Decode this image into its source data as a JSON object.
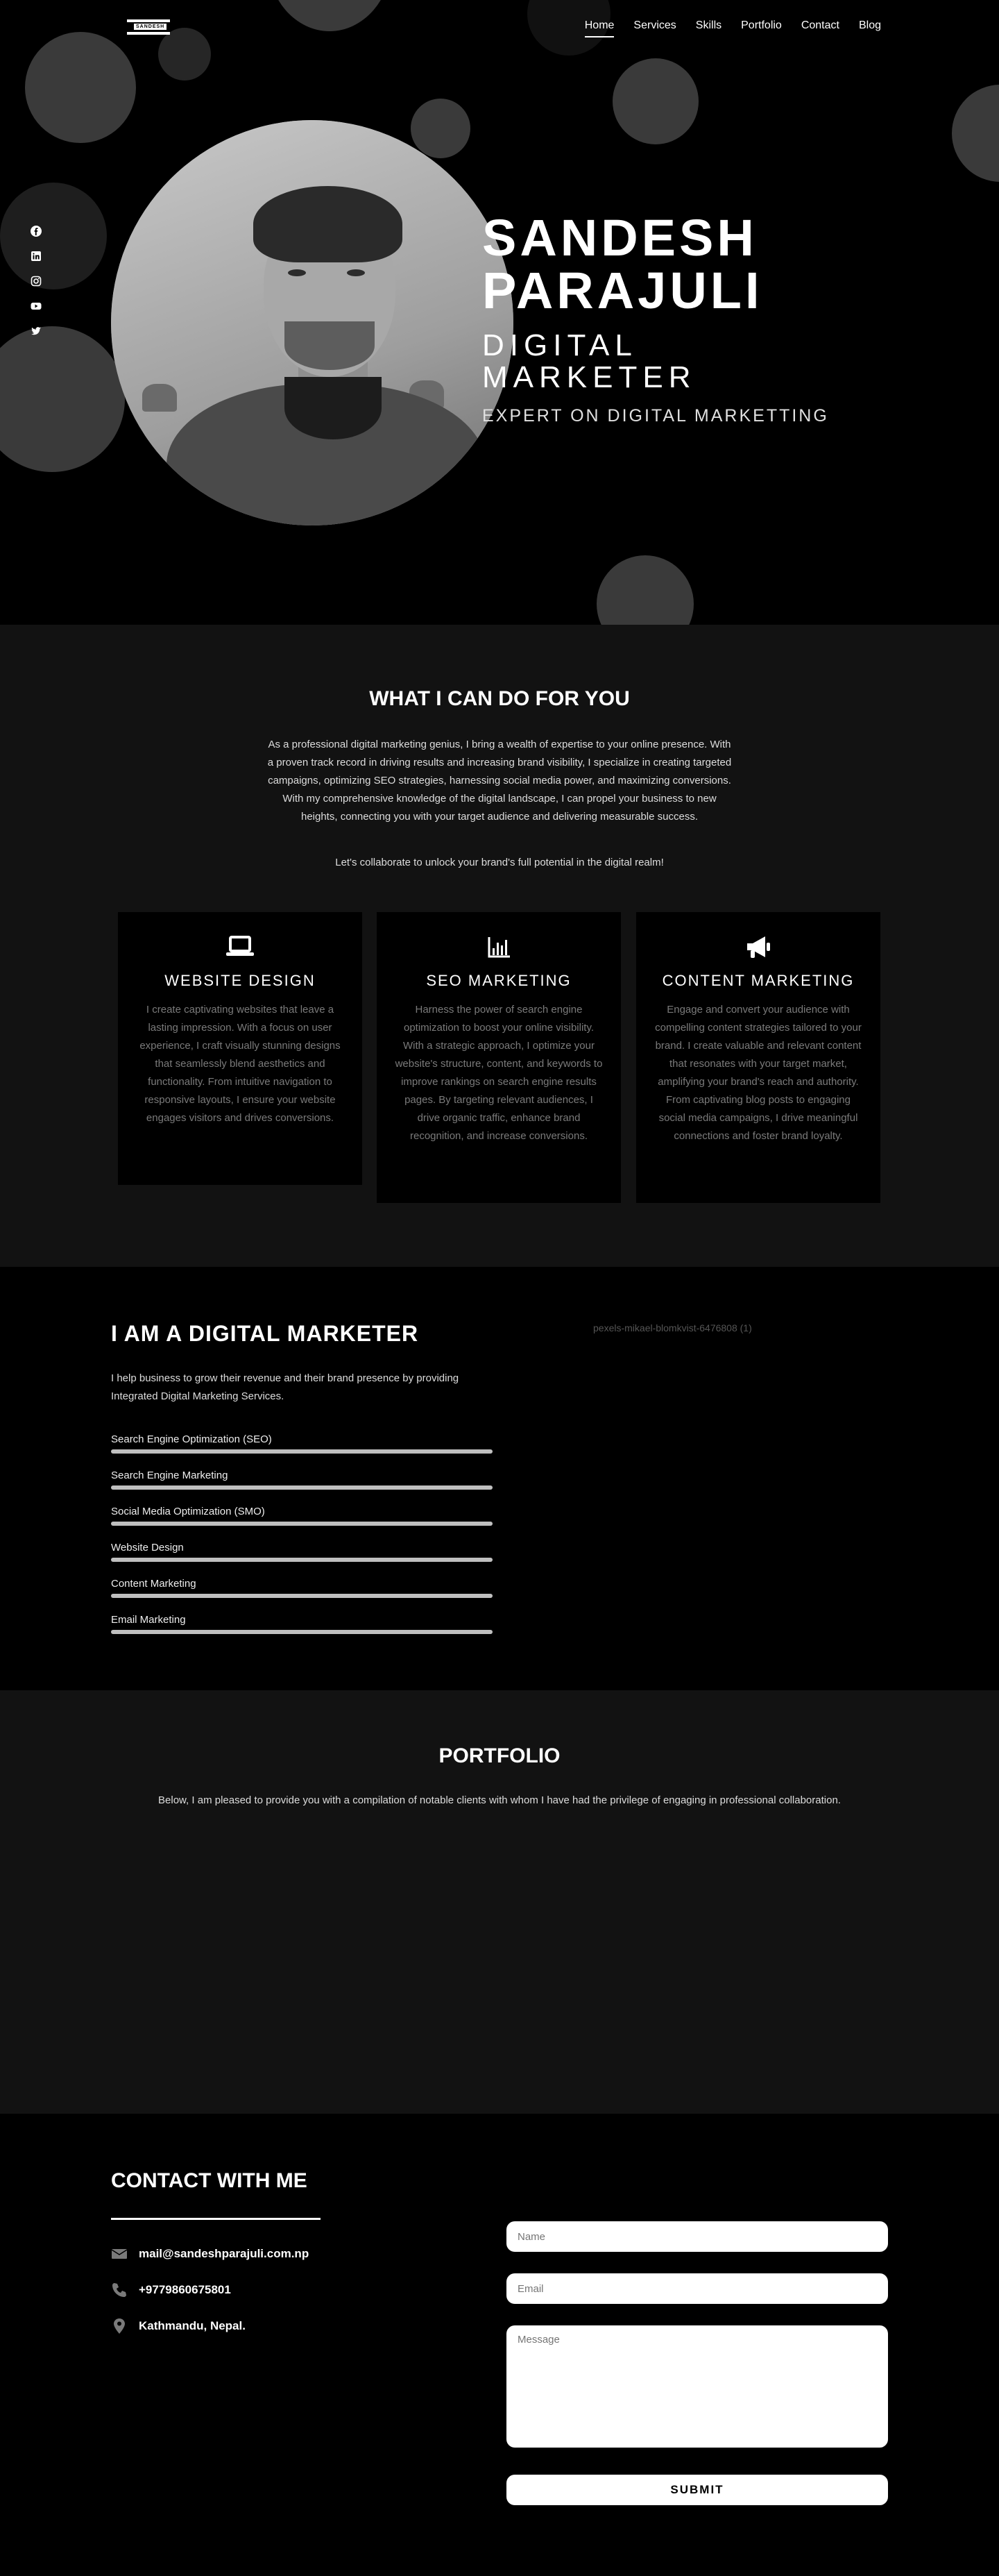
{
  "logo": {
    "text": "SANDESH"
  },
  "nav": [
    {
      "label": "Home"
    },
    {
      "label": "Services"
    },
    {
      "label": "Skills"
    },
    {
      "label": "Portfolio"
    },
    {
      "label": "Contact"
    },
    {
      "label": "Blog"
    }
  ],
  "social_icons": [
    "facebook-icon",
    "linkedin-icon",
    "instagram-icon",
    "youtube-icon",
    "twitter-icon"
  ],
  "hero": {
    "name_line1": "SANDESH",
    "name_line2": "PARAJULI",
    "role_line1": "DIGITAL",
    "role_line2": "MARKETER",
    "tagline": "EXPERT ON DIGITAL MARKETTING"
  },
  "services": {
    "title": "WHAT I CAN DO FOR YOU",
    "intro": "As a professional digital marketing genius, I bring a wealth of expertise to your online presence. With a proven track record in driving results and increasing brand visibility, I specialize in creating targeted campaigns, optimizing SEO strategies, harnessing social media power, and maximizing conversions. With my comprehensive knowledge of the digital landscape, I can propel your business to new heights, connecting you with your target audience and delivering measurable success.",
    "collab": "Let's collaborate to unlock your brand's full potential in the digital realm!",
    "cards": [
      {
        "title": "WEBSITE DESIGN",
        "icon": "laptop-icon",
        "text": "I create captivating websites that leave a lasting impression. With a focus on user experience, I craft visually stunning designs that seamlessly blend aesthetics and functionality. From intuitive navigation to responsive layouts, I ensure your website engages visitors and drives conversions."
      },
      {
        "title": "SEO MARKETING",
        "icon": "bar-chart-icon",
        "text": "Harness the power of search engine optimization to boost your online visibility. With a strategic approach, I optimize your website's structure, content, and keywords to improve rankings on search engine results pages. By targeting relevant audiences, I drive organic traffic, enhance brand recognition, and increase conversions."
      },
      {
        "title": "CONTENT MARKETING",
        "icon": "megaphone-icon",
        "text": "Engage and convert your audience with compelling content strategies tailored to your brand. I create valuable and relevant content that resonates with your target market, amplifying your brand's reach and authority. From captivating blog posts to engaging social media campaigns, I drive meaningful connections and foster brand loyalty."
      }
    ]
  },
  "skills": {
    "title": "I AM A DIGITAL MARKETER",
    "lead": "I help business to grow their revenue and their brand presence by providing Integrated Digital Marketing Services.",
    "image_alt": "pexels-mikael-blomkvist-6476808 (1)",
    "items": [
      {
        "label": "Search Engine Optimization (SEO)",
        "level": 1.0
      },
      {
        "label": "Search Engine Marketing",
        "level": 1.0
      },
      {
        "label": "Social Media Optimization (SMO)",
        "level": 1.0
      },
      {
        "label": "Website Design",
        "level": 1.0
      },
      {
        "label": "Content Marketing",
        "level": 1.0
      },
      {
        "label": "Email Marketing",
        "level": 1.0
      }
    ]
  },
  "portfolio": {
    "title": "PORTFOLIO",
    "text": "Below, I am pleased to provide you with a compilation of notable clients with whom I have had the privilege of engaging in professional collaboration."
  },
  "contact": {
    "title": "CONTACT WITH ME",
    "email": "mail@sandeshparajuli.com.np",
    "phone": "+9779860675801",
    "address": "Kathmandu, Nepal.",
    "form": {
      "name_placeholder": "Name",
      "email_placeholder": "Email",
      "message_placeholder": "Message",
      "submit_label": "SUBMIT"
    }
  },
  "colors": {
    "background": "#000000",
    "section_alt": "#121212",
    "bubble": "#3a3a3a",
    "muted_text": "#7a7a7a"
  }
}
